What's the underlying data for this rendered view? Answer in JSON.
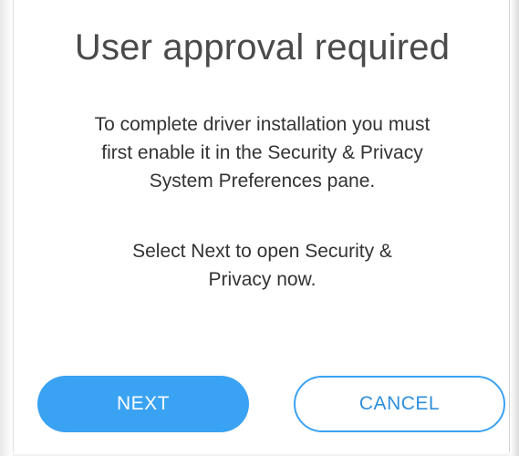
{
  "dialog": {
    "title": "User approval required",
    "message_1_lines": [
      "To complete driver installation you must",
      "first enable it in the Security & Privacy",
      "System Preferences pane."
    ],
    "message_2_lines": [
      "Select Next to open Security &",
      "Privacy now."
    ]
  },
  "buttons": {
    "next_label": "NEXT",
    "cancel_label": "CANCEL"
  },
  "colors": {
    "primary": "#3aa2f2",
    "primary_text": "#2f8fdc",
    "title_text": "#4a4a4a",
    "body_text": "#333333"
  }
}
